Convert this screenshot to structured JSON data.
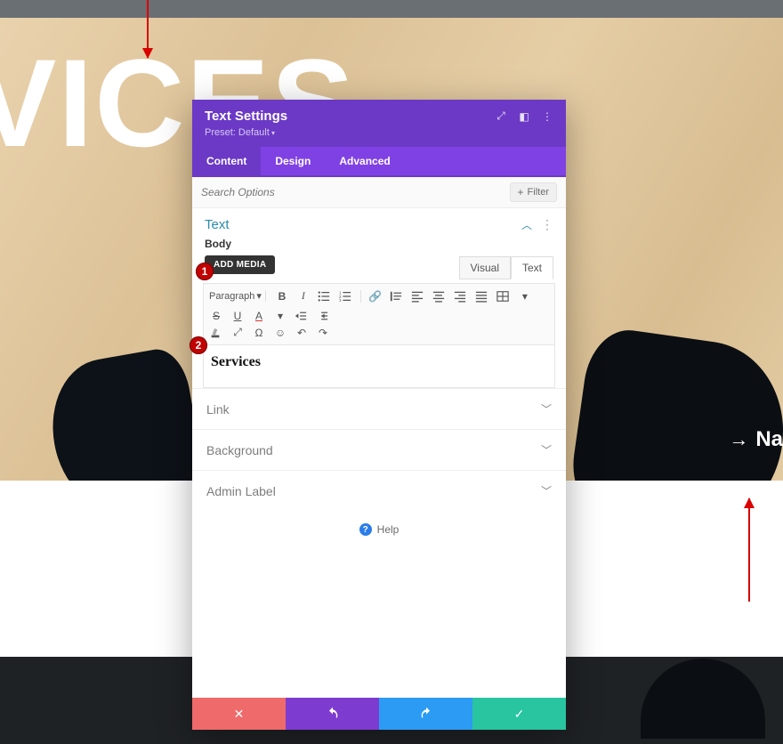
{
  "bg_heading": "VICES",
  "nav_hint": "Na",
  "callouts": {
    "c1": "1",
    "c2": "2"
  },
  "modal": {
    "title": "Text Settings",
    "preset": "Preset: Default",
    "tabs": {
      "content": "Content",
      "design": "Design",
      "advanced": "Advanced"
    },
    "search_placeholder": "Search Options",
    "filter_label": "Filter",
    "section_text": "Text",
    "body_label": "Body",
    "add_media": "ADD MEDIA",
    "editor_tabs": {
      "visual": "Visual",
      "text": "Text"
    },
    "format_select": "Paragraph",
    "editor_content": "Services",
    "accordion": {
      "link": "Link",
      "background": "Background",
      "admin_label": "Admin Label"
    },
    "help": "Help"
  }
}
